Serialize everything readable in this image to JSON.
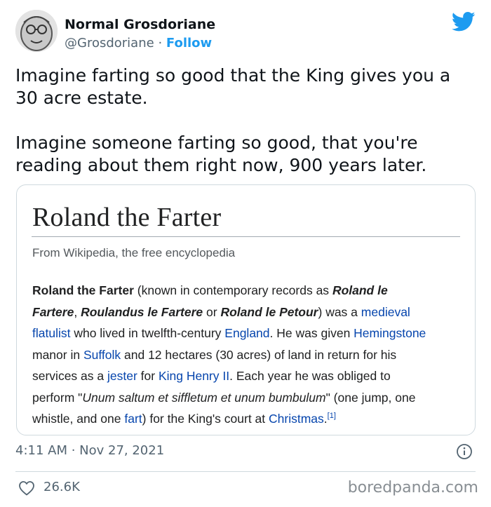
{
  "tweet": {
    "author_name": "Normal Grosdoriane",
    "handle": "@Grosdoriane",
    "separator": "·",
    "follow_label": "Follow",
    "text_paragraphs": [
      "Imagine farting so good that the King gives you a\n30 acre estate.",
      "Imagine someone farting so good, that you're\nreading about them right now, 900 years later."
    ],
    "timestamp": "4:11 AM · Nov 27, 2021",
    "likes": "26.6K"
  },
  "wiki": {
    "title": "Roland the Farter",
    "subtitle": "From Wikipedia, the free encyclopedia",
    "body": {
      "l1_name": "Roland the Farter",
      "l1_text": " (known in contemporary records as ",
      "l1_alias1": "Roland le",
      "l2_alias1b": "Fartere",
      "l2_sep1": ", ",
      "l2_alias2": "Roulandus le Fartere",
      "l2_or": " or ",
      "l2_alias3": "Roland le Petour",
      "l2_text": ") was a ",
      "l2_link_medieval": "medieval",
      "l3_link_flatulist": "flatulist",
      "l3_text": " who lived in twelfth-century ",
      "l3_link_england": "England",
      "l3_text2": ". He was given ",
      "l3_link_hemingstone": "Hemingstone",
      "l4_text": "manor in ",
      "l4_link_suffolk": "Suffolk",
      "l4_text2": " and 12 hectares (30 acres) of land in return for his",
      "l5_text": "services as a ",
      "l5_link_jester": "jester",
      "l5_text2": " for ",
      "l5_link_king": "King Henry II",
      "l5_text3": ". Each year he was obliged to",
      "l6_text": "perform \"",
      "l6_latin": "Unum saltum et siffletum et unum bumbulum",
      "l6_text2": "\" (one jump, one",
      "l7_text": "whistle, and one ",
      "l7_link_fart": "fart",
      "l7_text2": ") for the King's court at ",
      "l7_link_christmas": "Christmas",
      "l7_text3": ".",
      "l7_ref": "[1]"
    }
  },
  "watermark": "boredpanda.com",
  "colors": {
    "link_twitter": "#1d9bf0",
    "link_wiki": "#0645ad",
    "text_secondary": "#536471"
  },
  "icons": {
    "twitter": "twitter-bird-icon",
    "info": "info-icon",
    "heart": "heart-icon"
  }
}
